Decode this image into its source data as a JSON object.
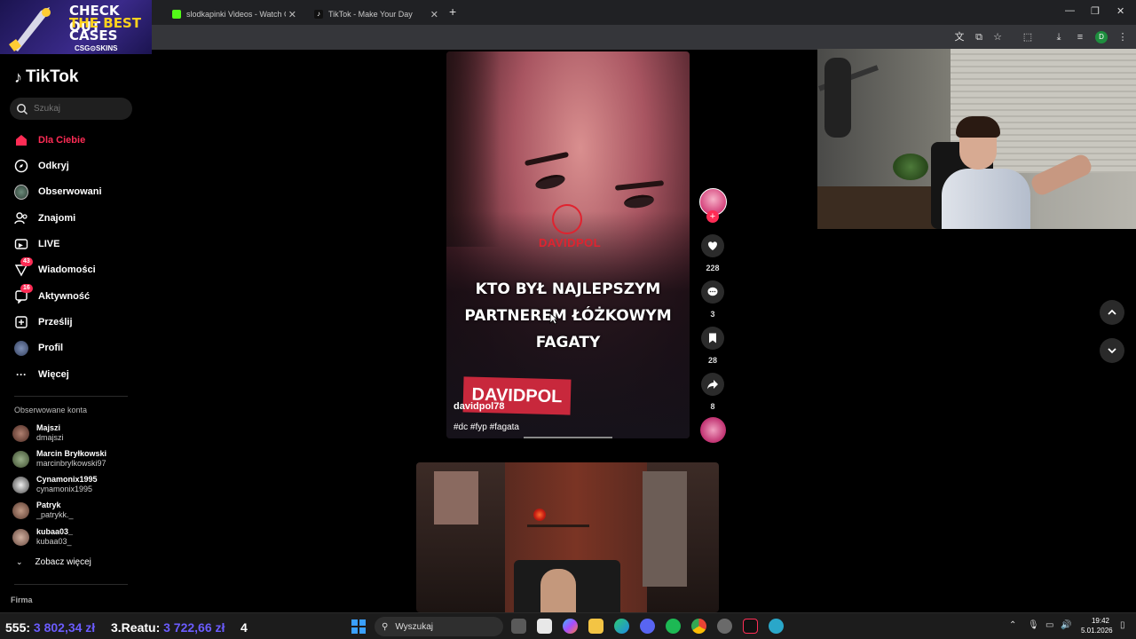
{
  "browser": {
    "tabs": [
      {
        "title": "slodkapinki Videos - Watch On"
      },
      {
        "title": "TikTok - Make Your Day"
      }
    ]
  },
  "ad": {
    "line1": "CHECK OUT",
    "line2": "THE BEST",
    "line3": "CASES",
    "brand": "CSG⊙SKINS"
  },
  "sidebar": {
    "logo": "TikTok",
    "search_placeholder": "Szukaj",
    "nav": [
      {
        "label": "Dla Ciebie",
        "icon": "home-icon",
        "active": true
      },
      {
        "label": "Odkryj",
        "icon": "compass-icon"
      },
      {
        "label": "Obserwowani",
        "icon": "avatar-icon"
      },
      {
        "label": "Znajomi",
        "icon": "friends-icon"
      },
      {
        "label": "LIVE",
        "icon": "live-icon"
      },
      {
        "label": "Wiadomości",
        "icon": "messages-icon",
        "badge": "43"
      },
      {
        "label": "Aktywność",
        "icon": "activity-icon",
        "badge": "16"
      },
      {
        "label": "Prześlij",
        "icon": "upload-icon"
      },
      {
        "label": "Profil",
        "icon": "profile-icon"
      },
      {
        "label": "Więcej",
        "icon": "more-icon"
      }
    ],
    "followed_title": "Obserwowane konta",
    "accounts": [
      {
        "name": "Majszi",
        "handle": "dmajszi"
      },
      {
        "name": "Marcin Bryłkowski",
        "handle": "marcinbrylkowski97"
      },
      {
        "name": "Cynamonix1995",
        "handle": "cynamonix1995"
      },
      {
        "name": "Patryk",
        "handle": "_patrykk._"
      },
      {
        "name": "kubaa03_",
        "handle": "kubaa03_"
      }
    ],
    "see_more": "Zobacz więcej",
    "footer": "Firma"
  },
  "video": {
    "watermark": "DAVIDPOL",
    "caption_lines": [
      "KTO BYŁ NAJLEPSZYM",
      "PARTNEREM ŁÓŻKOWYM",
      "FAGATY"
    ],
    "sticker": "DAVIDPOL",
    "username": "davidpol78",
    "tags": "#dc #fyp #fagata",
    "progress": 0.4,
    "likes": "228",
    "comments": "3",
    "saves": "28",
    "shares": "8"
  },
  "overlay": {
    "stat1_label": "555:",
    "stat1_value": "3 802,34 zł",
    "stat2_label": "3.Reatu:",
    "stat2_value": "3 722,66 zł",
    "stat3": "4"
  },
  "taskbar": {
    "search_placeholder": "Wyszukaj",
    "time": "19:42",
    "date": "5.01.2026"
  },
  "colors": {
    "accent": "#fe2c55",
    "overlay_value": "#6b5cff"
  }
}
